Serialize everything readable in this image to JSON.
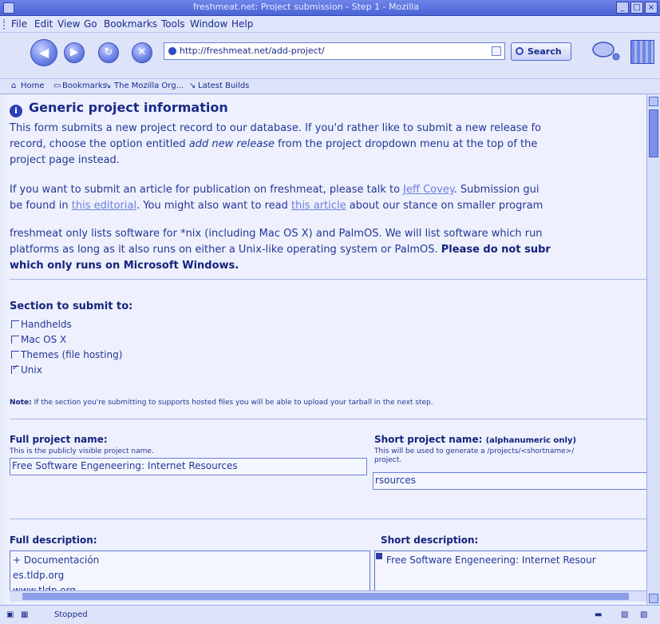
{
  "window": {
    "title": "freshmeat.net: Project submission - Step 1 - Mozilla"
  },
  "menu": [
    "File",
    "Edit",
    "View",
    "Go",
    "Bookmarks",
    "Tools",
    "Window",
    "Help"
  ],
  "navigation": {
    "url": "http://freshmeat.net/add-project/",
    "search_label": "Search"
  },
  "personal_toolbar": {
    "home": "Home",
    "bookmarks": "Bookmarks",
    "mozilla_org": "The Mozilla Org...",
    "latest_builds": "Latest Builds"
  },
  "page": {
    "heading": "Generic project information",
    "para1": {
      "line1": "This form submits a new project record to our database. If you'd rather like to submit a new release fo",
      "line2a": "record, choose the option entitled ",
      "line2_em": "add new release",
      "line2b": " from the project dropdown menu at the top of the",
      "line3": "project page instead."
    },
    "para2": {
      "line1a": "If you want to submit an article for publication on freshmeat, please talk to ",
      "link_jeff": "Jeff Covey",
      "line1b": ". Submission gui",
      "line2a": "be found in ",
      "link_editorial": "this editorial",
      "line2b": ". You might also want to read ",
      "link_article": "this article",
      "line2c": " about our stance on smaller program"
    },
    "para3": {
      "line1": "freshmeat only lists software for *nix (including Mac OS X) and PalmOS. We will list software which run",
      "line2a": "platforms as long as it also runs on either a Unix-like operating system or PalmOS. ",
      "line2_bold": "Please do not subr",
      "line3_bold": "which only runs on Microsoft Windows."
    },
    "section_label": "Section to submit to:",
    "sections": [
      {
        "label": "Handhelds",
        "checked": false
      },
      {
        "label": "Mac OS X",
        "checked": false
      },
      {
        "label": "Themes (file hosting)",
        "checked": false
      },
      {
        "label": "Unix",
        "checked": true
      }
    ],
    "note_label": "Note:",
    "note_text": " If the section you're submitting to supports hosted files you will be able to upload your tarball in the next step.",
    "full_name": {
      "label": "Full project name:",
      "help": "This is the publicly visible project name.",
      "value": "Free Software Engeneering: Internet Resources"
    },
    "short_name": {
      "label": "Short project name:",
      "label_small": "(alphanumeric only)",
      "help_line1": "This will be used to generate a /projects/<shortname>/",
      "help_line2": "project.",
      "value": "rsources"
    },
    "full_description": {
      "label": "Full description:",
      "value": "+ Documentación\nes.tldp.org\nwww.tldp.org"
    },
    "short_description": {
      "label": "Short description:",
      "value": "Free Software Engeneering: Internet Resour"
    }
  },
  "status": {
    "text": "Stopped"
  }
}
